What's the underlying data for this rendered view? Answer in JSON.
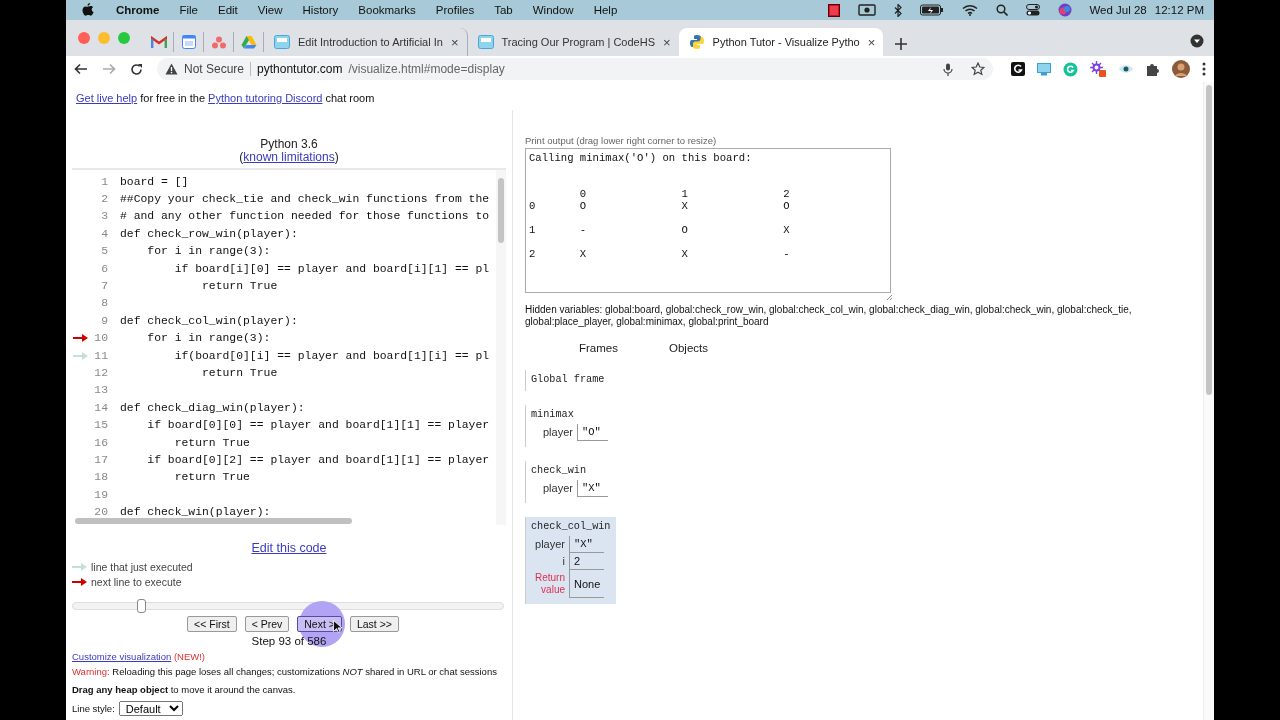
{
  "menubar": {
    "app": "Chrome",
    "items": [
      "File",
      "Edit",
      "View",
      "History",
      "Bookmarks",
      "Profiles",
      "Tab",
      "Window",
      "Help"
    ],
    "date": "Wed Jul 28",
    "time": "12:12 PM"
  },
  "tabs": [
    {
      "kind": "pinned",
      "selected": false
    },
    {
      "kind": "pinned",
      "selected": false
    },
    {
      "kind": "pinned",
      "selected": false
    },
    {
      "kind": "pinned",
      "selected": false
    },
    {
      "kind": "page",
      "label": "Edit Introduction to Artificial In",
      "close": "×",
      "selected": false
    },
    {
      "kind": "page",
      "label": "Tracing Our Program | CodeHS",
      "close": "×",
      "selected": false
    },
    {
      "kind": "page",
      "label": "Python Tutor - Visualize Pytho",
      "close": "×",
      "selected": true
    }
  ],
  "address_bar": {
    "security": "Not Secure",
    "host": "pythontutor.com",
    "path": "/visualize.html#mode=display"
  },
  "help_line": [
    {
      "kind": "link",
      "text": "Get live help"
    },
    {
      "kind": "text",
      "text": " for free in the "
    },
    {
      "kind": "link",
      "text": "Python tutoring Discord"
    },
    {
      "kind": "text",
      "text": " chat room"
    }
  ],
  "code_panel": {
    "title": "Python 3.6",
    "limitations": {
      "before": "(",
      "link": "known limitations",
      "after": ")"
    },
    "lines": [
      {
        "number": "1",
        "code": "board = []",
        "next_line": false,
        "just_executed": false
      },
      {
        "number": "2",
        "code": "##Copy your check_tie and check_win functions from the",
        "next_line": false,
        "just_executed": false
      },
      {
        "number": "3",
        "code": "# and any other function needed for those functions to",
        "next_line": false,
        "just_executed": false
      },
      {
        "number": "4",
        "code": "def check_row_win(player):",
        "next_line": false,
        "just_executed": false
      },
      {
        "number": "5",
        "code": "    for i in range(3):",
        "next_line": false,
        "just_executed": false
      },
      {
        "number": "6",
        "code": "        if board[i][0] == player and board[i][1] == pl",
        "next_line": false,
        "just_executed": false
      },
      {
        "number": "7",
        "code": "            return True",
        "next_line": false,
        "just_executed": false
      },
      {
        "number": "8",
        "next_line": false,
        "just_executed": false
      },
      {
        "number": "9",
        "code": "def check_col_win(player):",
        "next_line": false,
        "just_executed": false
      },
      {
        "number": "10",
        "code": "    for i in range(3):",
        "next_line": true,
        "just_executed": false
      },
      {
        "number": "11",
        "code": "        if(board[0][i] == player and board[1][i] == pl",
        "next_line": false,
        "just_executed": true
      },
      {
        "number": "12",
        "code": "            return True",
        "next_line": false,
        "just_executed": false
      },
      {
        "number": "13",
        "next_line": false,
        "just_executed": false
      },
      {
        "number": "14",
        "code": "def check_diag_win(player):",
        "next_line": false,
        "just_executed": false
      },
      {
        "number": "15",
        "code": "    if board[0][0] == player and board[1][1] == player",
        "next_line": false,
        "just_executed": false
      },
      {
        "number": "16",
        "code": "        return True",
        "next_line": false,
        "just_executed": false
      },
      {
        "number": "17",
        "code": "    if board[0][2] == player and board[1][1] == player",
        "next_line": false,
        "just_executed": false
      },
      {
        "number": "18",
        "code": "        return True",
        "next_line": false,
        "just_executed": false
      },
      {
        "number": "19",
        "next_line": false,
        "just_executed": false
      },
      {
        "number": "20",
        "code": "def check_win(player):",
        "next_line": false,
        "just_executed": false
      }
    ],
    "edit_link": "Edit this code"
  },
  "legend": [
    {
      "kind": "prev",
      "text": "line that just executed"
    },
    {
      "kind": "next",
      "text": "next line to execute"
    }
  ],
  "stepper": {
    "level": 0.159,
    "buttons": [
      "<< First",
      "< Prev",
      "Next >",
      "Last >>"
    ],
    "step": "Step 93 of 586"
  },
  "customize": {
    "link": "Customize visualization",
    "badge": "(NEW!)"
  },
  "warning": {
    "label": "Warning:",
    "text": "Reloading this page loses all changes; customizations *NOT* shared in URL or chat sessions"
  },
  "drag_note": "**Drag any heap object** to move it around the canvas.",
  "line_style": {
    "label": "Line style:",
    "value": "Default"
  },
  "print_output": {
    "label": "Print output (drag lower right corner to resize)",
    "text": "Calling minimax('O') on this board:\n\n\n        0               1               2\n0       O               X               O\n\n1       -               O               X\n\n2       X               X               -"
  },
  "hidden_variables": "Hidden variables: global:board, global:check_row_win, global:check_col_win, global:check_diag_win, global:check_win, global:check_tie, global:place_player, global:minimax, global:print_board",
  "headers": [
    "Frames",
    "Objects"
  ],
  "frames": [
    {
      "name": "Global frame",
      "highlighted": false
    },
    {
      "name": "minimax",
      "highlighted": false,
      "vars": [
        {
          "kind": "var",
          "name": "player",
          "value": "\"O\""
        }
      ]
    },
    {
      "name": "check_win",
      "highlighted": false,
      "vars": [
        {
          "kind": "var",
          "name": "player",
          "value": "\"X\""
        }
      ]
    },
    {
      "name": "check_col_win",
      "highlighted": true,
      "vars": [
        {
          "kind": "var",
          "name": "player",
          "value": "\"X\""
        },
        {
          "kind": "var",
          "name": "i",
          "value": "2"
        },
        {
          "kind": "return",
          "name": "Return value",
          "value": "None"
        }
      ]
    }
  ]
}
